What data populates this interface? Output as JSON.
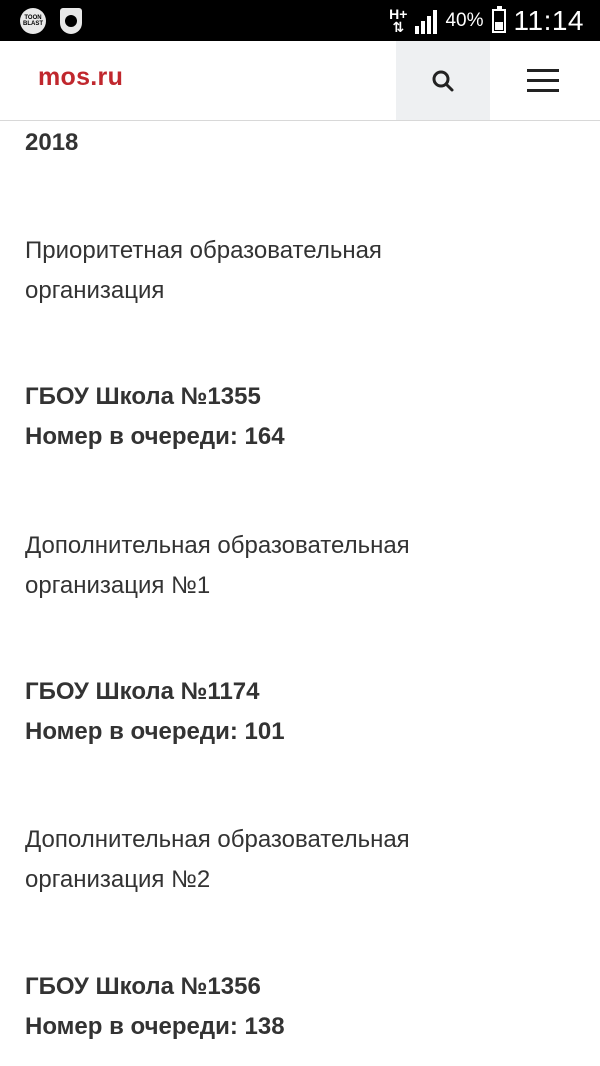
{
  "status_bar": {
    "left_icons": [
      "toon-blast-app-icon",
      "drweb-shield-icon"
    ],
    "toon_badge": "TOON BLAST",
    "network": "H+",
    "battery_percent": "40%",
    "battery_level": 0.4,
    "time": "11:14",
    "colors": {
      "background": "#000000",
      "foreground": "#ffffff"
    }
  },
  "header": {
    "logo": "mos.ru",
    "search_icon": "search-icon",
    "menu_icon": "hamburger-menu-icon",
    "colors": {
      "logo": "#c0272d",
      "search_bg": "#eef0f2"
    }
  },
  "content": {
    "year": "2018",
    "priority_label_line1": "Приоритетная образовательная",
    "priority_label_line2": "организация",
    "school1_name": "ГБОУ Школа №1355",
    "school1_queue": "Номер в очереди: 164",
    "extra1_label_line1": "Дополнительная образовательная",
    "extra1_label_line2": "организация №1",
    "school2_name": "ГБОУ Школа №1174",
    "school2_queue": "Номер в очереди: 101",
    "extra2_label_line1": "Дополнительная образовательная",
    "extra2_label_line2": "организация №2",
    "school3_name": "ГБОУ Школа №1356",
    "school3_queue": "Номер в очереди: 138"
  }
}
